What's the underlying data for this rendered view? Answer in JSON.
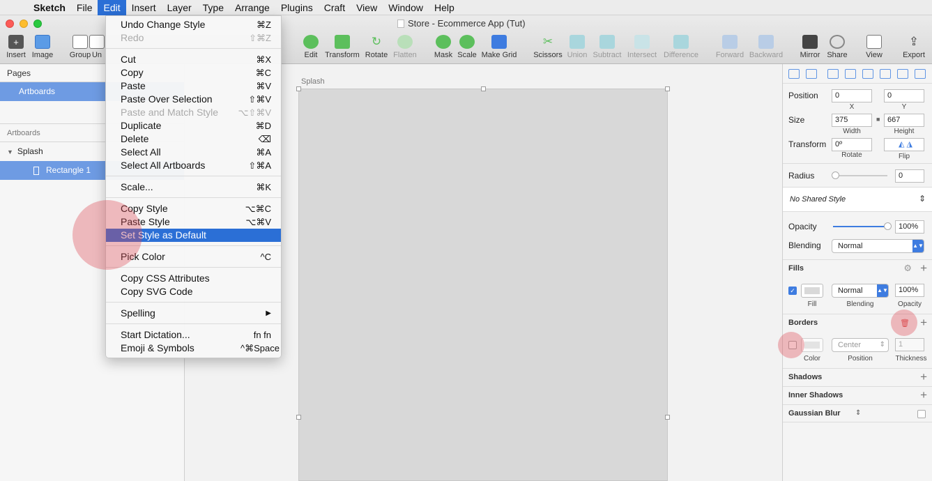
{
  "menubar": {
    "items": [
      "Sketch",
      "File",
      "Edit",
      "Insert",
      "Layer",
      "Type",
      "Arrange",
      "Plugins",
      "Craft",
      "View",
      "Window",
      "Help"
    ],
    "active": "Edit"
  },
  "window": {
    "title": "Store - Ecommerce App (Tut)"
  },
  "toolbar": {
    "insert": "Insert",
    "image": "Image",
    "group": "Group",
    "ungroup": "Un",
    "edit": "Edit",
    "transform": "Transform",
    "rotate": "Rotate",
    "flatten": "Flatten",
    "mask": "Mask",
    "scale": "Scale",
    "make_grid": "Make Grid",
    "scissors": "Scissors",
    "union": "Union",
    "subtract": "Subtract",
    "intersect": "Intersect",
    "difference": "Difference",
    "forward": "Forward",
    "backward": "Backward",
    "mirror": "Mirror",
    "share": "Share",
    "view": "View",
    "export": "Export"
  },
  "sidebar": {
    "pages_title": "Pages",
    "pages": [
      "Artboards"
    ],
    "layers_title": "Artboards",
    "artboard": "Splash",
    "layer": "Rectangle 1"
  },
  "canvas": {
    "artboard_label": "Splash"
  },
  "edit_menu": {
    "items": [
      {
        "label": "Undo Change Style",
        "shortcut": "⌘Z"
      },
      {
        "label": "Redo",
        "shortcut": "⇧⌘Z"
      },
      {
        "label": "Cut",
        "shortcut": "⌘X"
      },
      {
        "label": "Copy",
        "shortcut": "⌘C"
      },
      {
        "label": "Paste",
        "shortcut": "⌘V"
      },
      {
        "label": "Paste Over Selection",
        "shortcut": "⇧⌘V"
      },
      {
        "label": "Paste and Match Style",
        "shortcut": "⌥⇧⌘V"
      },
      {
        "label": "Duplicate",
        "shortcut": "⌘D"
      },
      {
        "label": "Delete",
        "shortcut": "⌫"
      },
      {
        "label": "Select All",
        "shortcut": "⌘A"
      },
      {
        "label": "Select All Artboards",
        "shortcut": "⇧⌘A"
      },
      {
        "label": "Scale...",
        "shortcut": "⌘K"
      },
      {
        "label": "Copy Style",
        "shortcut": "⌥⌘C"
      },
      {
        "label": "Paste Style",
        "shortcut": "⌥⌘V"
      },
      {
        "label": "Set Style as Default",
        "shortcut": ""
      },
      {
        "label": "Pick Color",
        "shortcut": "^C"
      },
      {
        "label": "Copy CSS Attributes",
        "shortcut": ""
      },
      {
        "label": "Copy SVG Code",
        "shortcut": ""
      },
      {
        "label": "Spelling",
        "shortcut": "▶"
      },
      {
        "label": "Start Dictation...",
        "shortcut": "fn fn"
      },
      {
        "label": "Emoji & Symbols",
        "shortcut": "^⌘Space"
      }
    ]
  },
  "inspector": {
    "position_label": "Position",
    "pos_x": "0",
    "pos_y": "0",
    "x_label": "X",
    "y_label": "Y",
    "size_label": "Size",
    "width": "375",
    "height": "667",
    "width_label": "Width",
    "height_label": "Height",
    "transform_label": "Transform",
    "rotate_value": "0º",
    "rotate_label": "Rotate",
    "flip_label": "Flip",
    "radius_label": "Radius",
    "radius_value": "0",
    "shared_style": "No Shared Style",
    "opacity_label": "Opacity",
    "opacity_value": "100%",
    "blending_label": "Blending",
    "blending_value": "Normal",
    "fills_title": "Fills",
    "fill_label": "Fill",
    "fill_blend": "Normal",
    "fill_blend_label": "Blending",
    "fill_opacity": "100%",
    "fill_opacity_label": "Opacity",
    "borders_title": "Borders",
    "border_color_label": "Color",
    "border_position": "Center",
    "border_position_label": "Position",
    "border_thickness": "1",
    "border_thickness_label": "Thickness",
    "shadows_title": "Shadows",
    "inner_shadows_title": "Inner Shadows",
    "blur_title": "Gaussian Blur"
  },
  "colors": {
    "accent": "#2b6fd6",
    "selection": "#6e9be3",
    "artboard": "#d8d8d8"
  }
}
